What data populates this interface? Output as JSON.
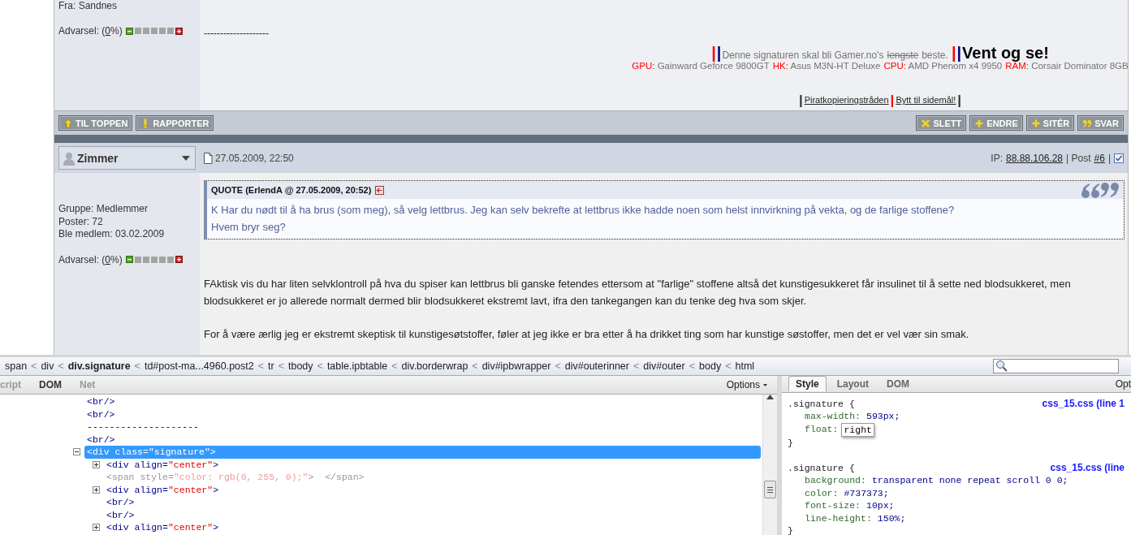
{
  "previous_post": {
    "user_info": [
      "Fra: Sandnes"
    ],
    "warning": {
      "prefix": "Advarsel: (",
      "link": "0",
      "suffix": "%)",
      "level": 0
    },
    "separator_text": "--------------------",
    "signature": [
      {
        "kind": "bar",
        "text": "|",
        "color": "#ff0000"
      },
      {
        "kind": "bar",
        "text": "|",
        "color": "#000080"
      },
      {
        "kind": "text",
        "text": "Denne signaturen skal bli Gamer.no's"
      },
      {
        "kind": "strike",
        "text": "lengste"
      },
      {
        "kind": "text",
        "text": "beste."
      },
      {
        "kind": "bar",
        "text": "|",
        "color": "#ff0000"
      },
      {
        "kind": "bar",
        "text": "|",
        "color": "#000080"
      },
      {
        "kind": "big",
        "text": "Vent og se!"
      }
    ],
    "specs": [
      {
        "label": "GPU:",
        "value": "Gainward Geforce 9800GT"
      },
      {
        "label": "HK:",
        "value": "Asus M3N-HT Deluxe"
      },
      {
        "label": "CPU:",
        "value": "AMD Phenom x4 9950"
      },
      {
        "label": "RAM:",
        "value": "Corsair Dominator 8GB"
      }
    ],
    "links": [
      {
        "kind": "bar",
        "text": "|",
        "color": "#333333"
      },
      {
        "kind": "link",
        "text": "Piratkopieringstråden"
      },
      {
        "kind": "bar",
        "text": "|",
        "color": "#ff0000"
      },
      {
        "kind": "link",
        "text": "Bytt til sidemål!"
      },
      {
        "kind": "bar",
        "text": "|",
        "color": "#333333"
      }
    ]
  },
  "action_bar": {
    "left": [
      {
        "label": "TIL TOPPEN",
        "kind": "up"
      },
      {
        "label": "RAPPORTER",
        "kind": "exclaim"
      }
    ],
    "right": [
      {
        "label": "SLETT",
        "kind": "cross"
      },
      {
        "label": "ENDRE",
        "kind": "plus"
      },
      {
        "label": "SITÉR",
        "kind": "plus"
      },
      {
        "label": "SVAR",
        "kind": "quote"
      }
    ]
  },
  "post": {
    "author": "Zimmer",
    "date": "27.05.2009, 22:50",
    "ip_label": "IP:",
    "ip": "88.88.106.28",
    "post_label": "| Post",
    "post_number": "#6",
    "trailing_bar": "|",
    "select_checkbox": {
      "checked": true
    },
    "user_info": [
      "Gruppe: Medlemmer",
      "Poster: 72",
      "Ble medlem: 03.02.2009"
    ],
    "warning": {
      "prefix": "Advarsel: (",
      "link": "0",
      "suffix": "%)",
      "level": 0
    },
    "quote": {
      "header": "QUOTE (ErlendA @ 27.05.2009, 20:52)",
      "lines": [
        "K Har du nødt til å ha brus (som meg), så velg lettbrus. Jeg kan selv bekrefte at lettbrus ikke hadde noen som helst innvirkning på vekta, og de farlige stoffene?",
        "Hvem bryr seg?"
      ]
    },
    "paragraphs": [
      "FAktisk vis du har liten selvklontroll på hva du spiser kan lettbrus bli ganske fetendes ettersom at \"farlige\" stoffene altså det kunstigesukkeret får insulinet til å sette ned blodsukkeret, men blodsukkeret er jo allerede normalt dermed blir blodsukkeret ekstremt lavt, ifra den tankegangen kan du tenke deg hva som skjer.",
      "For å være ærlig jeg er ekstremt skeptisk til kunstigesøtstoffer, føler at jeg ikke er bra etter å ha drikket ting som har kunstige søstoffer, men det er vel vær sin smak."
    ]
  },
  "devtools": {
    "breadcrumb": [
      {
        "label": "span",
        "separator": "<",
        "selected": false
      },
      {
        "label": "div",
        "separator": "<",
        "selected": false
      },
      {
        "label": "div.signature",
        "separator": "<",
        "selected": true
      },
      {
        "label": "td#post-ma...4960.post2",
        "separator": "<",
        "selected": false
      },
      {
        "label": "tr",
        "separator": "<",
        "selected": false
      },
      {
        "label": "tbody",
        "separator": "<",
        "selected": false
      },
      {
        "label": "table.ipbtable",
        "separator": "<",
        "selected": false
      },
      {
        "label": "div.borderwrap",
        "separator": "<",
        "selected": false
      },
      {
        "label": "div#ipbwrapper",
        "separator": "<",
        "selected": false
      },
      {
        "label": "div#outerinner",
        "separator": "<",
        "selected": false
      },
      {
        "label": "div#outer",
        "separator": "<",
        "selected": false
      },
      {
        "label": "body",
        "separator": "<",
        "selected": false
      },
      {
        "label": "html",
        "selected": false
      }
    ],
    "panel_tabs": [
      {
        "label": "cript",
        "disabled": true
      },
      {
        "label": "DOM",
        "disabled": false
      },
      {
        "label": "Net",
        "disabled": true
      }
    ],
    "options_label": "Options",
    "tree": [
      {
        "kind": "element",
        "markup": "<br/>",
        "selected": false,
        "dim": false
      },
      {
        "kind": "element",
        "markup": "<br/>",
        "selected": false,
        "dim": false
      },
      {
        "kind": "text",
        "markup": "--------------------",
        "selected": false,
        "dim": false
      },
      {
        "kind": "element",
        "markup": "<br/>",
        "selected": false,
        "dim": false
      },
      {
        "kind": "expanded",
        "markup": "<div class=\"signature\">",
        "selected": true,
        "dim": false,
        "children": [
          {
            "kind": "collapsed",
            "markup": "<div align=\"center\">",
            "selected": false,
            "dim": false
          },
          {
            "kind": "element",
            "markup": "<span style=\"color: rgb(0, 255, 0);\">  </span>",
            "selected": false,
            "dim": true
          },
          {
            "kind": "collapsed",
            "markup": "<div align=\"center\">",
            "selected": false,
            "dim": false
          },
          {
            "kind": "element",
            "markup": "<br/>",
            "selected": false,
            "dim": false
          },
          {
            "kind": "element",
            "markup": "<br/>",
            "selected": false,
            "dim": false
          },
          {
            "kind": "collapsed",
            "markup": "<div align=\"center\">",
            "selected": false,
            "dim": false
          }
        ]
      }
    ],
    "side_tabs": [
      {
        "label": "Style",
        "selected": true
      },
      {
        "label": "Layout",
        "selected": false
      },
      {
        "label": "DOM",
        "selected": false
      }
    ],
    "side_options_label": "Opt",
    "rules": [
      {
        "selector": ".signature",
        "open": "{",
        "close": "}",
        "source": "css_15.css (line 1",
        "properties": [
          {
            "name": "max-width:",
            "value": "593px;",
            "editing": false
          },
          {
            "name": "float:",
            "value": "right",
            "editing": true
          }
        ]
      },
      {
        "selector": ".signature",
        "open": "{",
        "close": "}",
        "source": "css_15.css (line",
        "properties": [
          {
            "name": "background:",
            "value": "transparent none repeat scroll 0 0;",
            "editing": false
          },
          {
            "name": "color:",
            "value": "#737373;",
            "editing": false
          },
          {
            "name": "font-size:",
            "value": "10px;",
            "editing": false
          },
          {
            "name": "line-height:",
            "value": "150%;",
            "editing": false
          }
        ]
      }
    ]
  }
}
